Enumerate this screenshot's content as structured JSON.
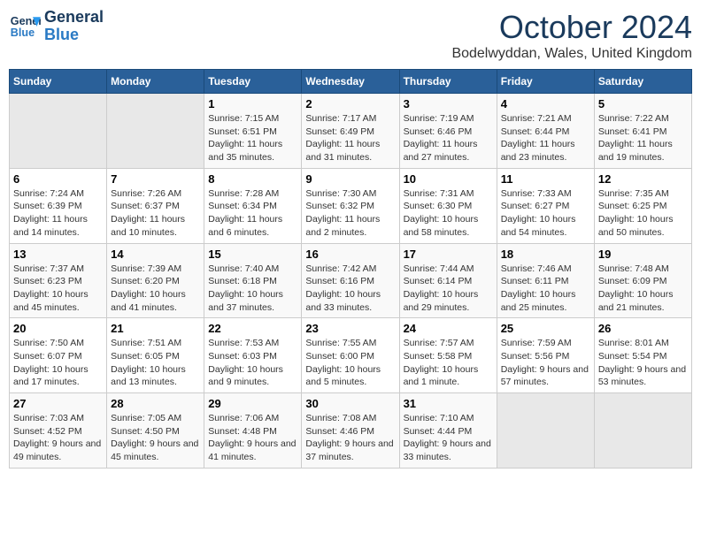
{
  "header": {
    "logo_line1": "General",
    "logo_line2": "Blue",
    "month_title": "October 2024",
    "location": "Bodelwyddan, Wales, United Kingdom"
  },
  "days_of_week": [
    "Sunday",
    "Monday",
    "Tuesday",
    "Wednesday",
    "Thursday",
    "Friday",
    "Saturday"
  ],
  "weeks": [
    [
      {
        "day": "",
        "sunrise": "",
        "sunset": "",
        "daylight": ""
      },
      {
        "day": "",
        "sunrise": "",
        "sunset": "",
        "daylight": ""
      },
      {
        "day": "1",
        "sunrise": "Sunrise: 7:15 AM",
        "sunset": "Sunset: 6:51 PM",
        "daylight": "Daylight: 11 hours and 35 minutes."
      },
      {
        "day": "2",
        "sunrise": "Sunrise: 7:17 AM",
        "sunset": "Sunset: 6:49 PM",
        "daylight": "Daylight: 11 hours and 31 minutes."
      },
      {
        "day": "3",
        "sunrise": "Sunrise: 7:19 AM",
        "sunset": "Sunset: 6:46 PM",
        "daylight": "Daylight: 11 hours and 27 minutes."
      },
      {
        "day": "4",
        "sunrise": "Sunrise: 7:21 AM",
        "sunset": "Sunset: 6:44 PM",
        "daylight": "Daylight: 11 hours and 23 minutes."
      },
      {
        "day": "5",
        "sunrise": "Sunrise: 7:22 AM",
        "sunset": "Sunset: 6:41 PM",
        "daylight": "Daylight: 11 hours and 19 minutes."
      }
    ],
    [
      {
        "day": "6",
        "sunrise": "Sunrise: 7:24 AM",
        "sunset": "Sunset: 6:39 PM",
        "daylight": "Daylight: 11 hours and 14 minutes."
      },
      {
        "day": "7",
        "sunrise": "Sunrise: 7:26 AM",
        "sunset": "Sunset: 6:37 PM",
        "daylight": "Daylight: 11 hours and 10 minutes."
      },
      {
        "day": "8",
        "sunrise": "Sunrise: 7:28 AM",
        "sunset": "Sunset: 6:34 PM",
        "daylight": "Daylight: 11 hours and 6 minutes."
      },
      {
        "day": "9",
        "sunrise": "Sunrise: 7:30 AM",
        "sunset": "Sunset: 6:32 PM",
        "daylight": "Daylight: 11 hours and 2 minutes."
      },
      {
        "day": "10",
        "sunrise": "Sunrise: 7:31 AM",
        "sunset": "Sunset: 6:30 PM",
        "daylight": "Daylight: 10 hours and 58 minutes."
      },
      {
        "day": "11",
        "sunrise": "Sunrise: 7:33 AM",
        "sunset": "Sunset: 6:27 PM",
        "daylight": "Daylight: 10 hours and 54 minutes."
      },
      {
        "day": "12",
        "sunrise": "Sunrise: 7:35 AM",
        "sunset": "Sunset: 6:25 PM",
        "daylight": "Daylight: 10 hours and 50 minutes."
      }
    ],
    [
      {
        "day": "13",
        "sunrise": "Sunrise: 7:37 AM",
        "sunset": "Sunset: 6:23 PM",
        "daylight": "Daylight: 10 hours and 45 minutes."
      },
      {
        "day": "14",
        "sunrise": "Sunrise: 7:39 AM",
        "sunset": "Sunset: 6:20 PM",
        "daylight": "Daylight: 10 hours and 41 minutes."
      },
      {
        "day": "15",
        "sunrise": "Sunrise: 7:40 AM",
        "sunset": "Sunset: 6:18 PM",
        "daylight": "Daylight: 10 hours and 37 minutes."
      },
      {
        "day": "16",
        "sunrise": "Sunrise: 7:42 AM",
        "sunset": "Sunset: 6:16 PM",
        "daylight": "Daylight: 10 hours and 33 minutes."
      },
      {
        "day": "17",
        "sunrise": "Sunrise: 7:44 AM",
        "sunset": "Sunset: 6:14 PM",
        "daylight": "Daylight: 10 hours and 29 minutes."
      },
      {
        "day": "18",
        "sunrise": "Sunrise: 7:46 AM",
        "sunset": "Sunset: 6:11 PM",
        "daylight": "Daylight: 10 hours and 25 minutes."
      },
      {
        "day": "19",
        "sunrise": "Sunrise: 7:48 AM",
        "sunset": "Sunset: 6:09 PM",
        "daylight": "Daylight: 10 hours and 21 minutes."
      }
    ],
    [
      {
        "day": "20",
        "sunrise": "Sunrise: 7:50 AM",
        "sunset": "Sunset: 6:07 PM",
        "daylight": "Daylight: 10 hours and 17 minutes."
      },
      {
        "day": "21",
        "sunrise": "Sunrise: 7:51 AM",
        "sunset": "Sunset: 6:05 PM",
        "daylight": "Daylight: 10 hours and 13 minutes."
      },
      {
        "day": "22",
        "sunrise": "Sunrise: 7:53 AM",
        "sunset": "Sunset: 6:03 PM",
        "daylight": "Daylight: 10 hours and 9 minutes."
      },
      {
        "day": "23",
        "sunrise": "Sunrise: 7:55 AM",
        "sunset": "Sunset: 6:00 PM",
        "daylight": "Daylight: 10 hours and 5 minutes."
      },
      {
        "day": "24",
        "sunrise": "Sunrise: 7:57 AM",
        "sunset": "Sunset: 5:58 PM",
        "daylight": "Daylight: 10 hours and 1 minute."
      },
      {
        "day": "25",
        "sunrise": "Sunrise: 7:59 AM",
        "sunset": "Sunset: 5:56 PM",
        "daylight": "Daylight: 9 hours and 57 minutes."
      },
      {
        "day": "26",
        "sunrise": "Sunrise: 8:01 AM",
        "sunset": "Sunset: 5:54 PM",
        "daylight": "Daylight: 9 hours and 53 minutes."
      }
    ],
    [
      {
        "day": "27",
        "sunrise": "Sunrise: 7:03 AM",
        "sunset": "Sunset: 4:52 PM",
        "daylight": "Daylight: 9 hours and 49 minutes."
      },
      {
        "day": "28",
        "sunrise": "Sunrise: 7:05 AM",
        "sunset": "Sunset: 4:50 PM",
        "daylight": "Daylight: 9 hours and 45 minutes."
      },
      {
        "day": "29",
        "sunrise": "Sunrise: 7:06 AM",
        "sunset": "Sunset: 4:48 PM",
        "daylight": "Daylight: 9 hours and 41 minutes."
      },
      {
        "day": "30",
        "sunrise": "Sunrise: 7:08 AM",
        "sunset": "Sunset: 4:46 PM",
        "daylight": "Daylight: 9 hours and 37 minutes."
      },
      {
        "day": "31",
        "sunrise": "Sunrise: 7:10 AM",
        "sunset": "Sunset: 4:44 PM",
        "daylight": "Daylight: 9 hours and 33 minutes."
      },
      {
        "day": "",
        "sunrise": "",
        "sunset": "",
        "daylight": ""
      },
      {
        "day": "",
        "sunrise": "",
        "sunset": "",
        "daylight": ""
      }
    ]
  ]
}
